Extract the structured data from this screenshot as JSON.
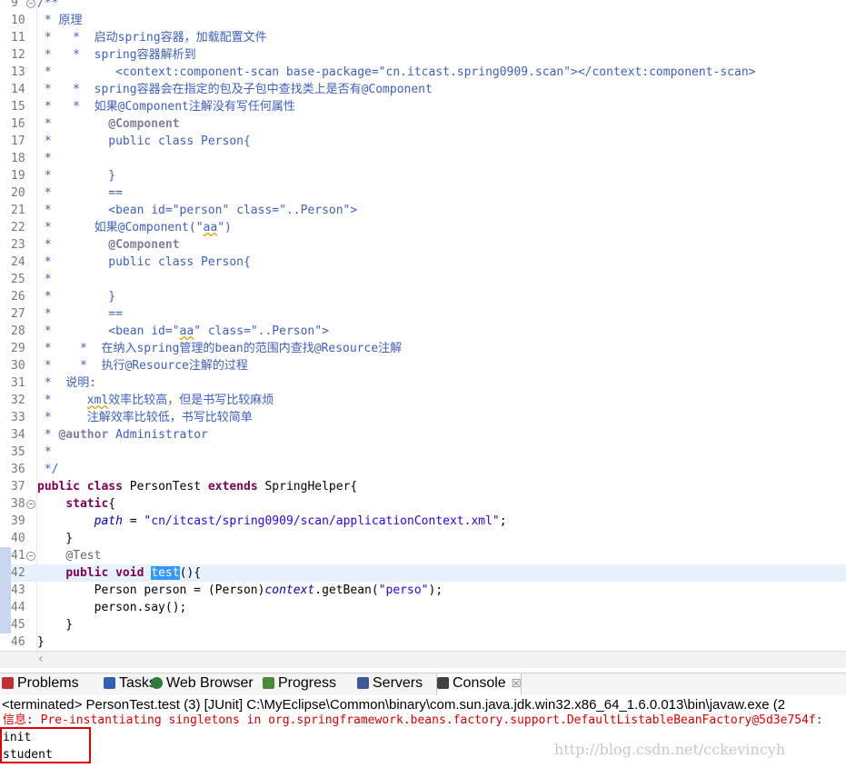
{
  "editor": {
    "lines": [
      {
        "n": "9",
        "fold": "−",
        "segs": [
          {
            "c": "cm",
            "t": "/**"
          }
        ]
      },
      {
        "n": "10",
        "segs": [
          {
            "c": "cm",
            "t": " * 原理"
          }
        ]
      },
      {
        "n": "11",
        "segs": [
          {
            "c": "cm",
            "t": " *   *  启动spring容器，加载配置文件"
          }
        ]
      },
      {
        "n": "12",
        "segs": [
          {
            "c": "cm",
            "t": " *   *  spring容器解析到"
          }
        ]
      },
      {
        "n": "13",
        "segs": [
          {
            "c": "cm",
            "t": " *         <context:component-scan base-package=\"cn.itcast.spring0909.scan\"></context:component-scan>"
          }
        ]
      },
      {
        "n": "14",
        "segs": [
          {
            "c": "cm",
            "t": " *   *  spring容器会在指定的包及子包中查找类上是否有@Component"
          }
        ]
      },
      {
        "n": "15",
        "segs": [
          {
            "c": "cm",
            "t": " *   *  如果@Component注解没有写任何属性"
          }
        ]
      },
      {
        "n": "16",
        "segs": [
          {
            "c": "cm",
            "t": " *        "
          },
          {
            "c": "tagcm",
            "t": "@Component"
          }
        ]
      },
      {
        "n": "17",
        "segs": [
          {
            "c": "cm",
            "t": " *        public class Person{"
          }
        ]
      },
      {
        "n": "18",
        "segs": [
          {
            "c": "cm",
            "t": " *"
          }
        ]
      },
      {
        "n": "19",
        "segs": [
          {
            "c": "cm",
            "t": " *        }"
          }
        ]
      },
      {
        "n": "20",
        "segs": [
          {
            "c": "cm",
            "t": " *        =="
          }
        ]
      },
      {
        "n": "21",
        "segs": [
          {
            "c": "cm",
            "t": " *        <bean id=\"person\" class=\"..Person\">"
          }
        ]
      },
      {
        "n": "22",
        "segs": [
          {
            "c": "cm",
            "t": " *      如果@Component(\""
          },
          {
            "c": "cm squig",
            "t": "aa"
          },
          {
            "c": "cm",
            "t": "\")"
          }
        ]
      },
      {
        "n": "23",
        "segs": [
          {
            "c": "cm",
            "t": " *        "
          },
          {
            "c": "tagcm",
            "t": "@Component"
          }
        ]
      },
      {
        "n": "24",
        "segs": [
          {
            "c": "cm",
            "t": " *        public class Person{"
          }
        ]
      },
      {
        "n": "25",
        "segs": [
          {
            "c": "cm",
            "t": " *"
          }
        ]
      },
      {
        "n": "26",
        "segs": [
          {
            "c": "cm",
            "t": " *        }"
          }
        ]
      },
      {
        "n": "27",
        "segs": [
          {
            "c": "cm",
            "t": " *        =="
          }
        ]
      },
      {
        "n": "28",
        "segs": [
          {
            "c": "cm",
            "t": " *        <bean id=\""
          },
          {
            "c": "cm squig",
            "t": "aa"
          },
          {
            "c": "cm",
            "t": "\" class=\"..Person\">"
          }
        ]
      },
      {
        "n": "29",
        "segs": [
          {
            "c": "cm",
            "t": " *    *  在纳入spring管理的bean的范围内查找@Resource注解"
          }
        ]
      },
      {
        "n": "30",
        "segs": [
          {
            "c": "cm",
            "t": " *    *  执行@Resource注解的过程"
          }
        ]
      },
      {
        "n": "31",
        "segs": [
          {
            "c": "cm",
            "t": " *  说明:"
          }
        ]
      },
      {
        "n": "32",
        "segs": [
          {
            "c": "cm",
            "t": " *     "
          },
          {
            "c": "cm squig",
            "t": "xml"
          },
          {
            "c": "cm",
            "t": "效率比较高，但是书写比较麻烦"
          }
        ]
      },
      {
        "n": "33",
        "segs": [
          {
            "c": "cm",
            "t": " *     注解效率比较低，书写比较简单"
          }
        ]
      },
      {
        "n": "34",
        "segs": [
          {
            "c": "cm",
            "t": " * "
          },
          {
            "c": "tagcm",
            "t": "@author"
          },
          {
            "c": "cm",
            "t": " Administrator"
          }
        ]
      },
      {
        "n": "35",
        "segs": [
          {
            "c": "cm",
            "t": " *"
          }
        ]
      },
      {
        "n": "36",
        "segs": [
          {
            "c": "cm",
            "t": " */"
          }
        ]
      },
      {
        "n": "37",
        "segs": [
          {
            "c": "kw",
            "t": "public"
          },
          {
            "c": "",
            "t": " "
          },
          {
            "c": "kw",
            "t": "class"
          },
          {
            "c": "",
            "t": " PersonTest "
          },
          {
            "c": "kw",
            "t": "extends"
          },
          {
            "c": "",
            "t": " SpringHelper{"
          }
        ]
      },
      {
        "n": "38",
        "fold": "−",
        "segs": [
          {
            "c": "",
            "t": "    "
          },
          {
            "c": "kw",
            "t": "static"
          },
          {
            "c": "",
            "t": "{"
          }
        ]
      },
      {
        "n": "39",
        "segs": [
          {
            "c": "",
            "t": "        "
          },
          {
            "c": "fld",
            "t": "path"
          },
          {
            "c": "",
            "t": " = "
          },
          {
            "c": "str",
            "t": "\"cn/itcast/spring0909/scan/applicationContext.xml\""
          },
          {
            "c": "",
            "t": ";"
          }
        ]
      },
      {
        "n": "40",
        "segs": [
          {
            "c": "",
            "t": "    }"
          }
        ]
      },
      {
        "n": "41",
        "fold": "−",
        "bar": true,
        "segs": [
          {
            "c": "",
            "t": "    "
          },
          {
            "c": "ann",
            "t": "@Test"
          }
        ]
      },
      {
        "n": "42",
        "bar": true,
        "current": true,
        "segs": [
          {
            "c": "",
            "t": "    "
          },
          {
            "c": "kw",
            "t": "public"
          },
          {
            "c": "",
            "t": " "
          },
          {
            "c": "kw",
            "t": "void"
          },
          {
            "c": "",
            "t": " "
          },
          {
            "c": "sel",
            "t": "test"
          },
          {
            "c": "",
            "t": "(){"
          }
        ]
      },
      {
        "n": "43",
        "bar": true,
        "segs": [
          {
            "c": "",
            "t": "        Person person = (Person)"
          },
          {
            "c": "fld",
            "t": "context"
          },
          {
            "c": "",
            "t": ".getBean("
          },
          {
            "c": "str",
            "t": "\"perso\""
          },
          {
            "c": "",
            "t": ");"
          }
        ]
      },
      {
        "n": "44",
        "bar": true,
        "segs": [
          {
            "c": "",
            "t": "        person.say();"
          }
        ]
      },
      {
        "n": "45",
        "bar": true,
        "segs": [
          {
            "c": "",
            "t": "    }"
          }
        ]
      },
      {
        "n": "46",
        "segs": [
          {
            "c": "",
            "t": "}"
          }
        ]
      }
    ]
  },
  "tabs": [
    {
      "label": "Problems",
      "icon": "problems-icon",
      "color": "#c03030"
    },
    {
      "label": "Tasks",
      "icon": "tasks-icon",
      "color": "#3060b0"
    },
    {
      "label": "Web Browser",
      "icon": "globe-icon",
      "color": "#2c7a3a"
    },
    {
      "label": "Progress",
      "icon": "progress-icon",
      "color": "#4a8a3a"
    },
    {
      "label": "Servers",
      "icon": "servers-icon",
      "color": "#3a5a9a"
    },
    {
      "label": "Console",
      "icon": "console-icon",
      "color": "#404040",
      "active": true,
      "close": "☒"
    }
  ],
  "console": {
    "terminated": "<terminated> PersonTest.test (3) [JUnit] C:\\MyEclipse\\Common\\binary\\com.sun.java.jdk.win32.x86_64_1.6.0.013\\bin\\javaw.exe (2",
    "info": "信息: Pre-instantiating singletons in org.springframework.beans.factory.support.DefaultListableBeanFactory@5d3e754f:",
    "out1": "init",
    "out2": "student"
  },
  "watermark": "http://blog.csdn.net/cckevincyh",
  "colors": {
    "comment": "#3f5fbf",
    "keyword": "#7f0055",
    "string": "#2a00ff",
    "field": "#0000c0",
    "selection": "#3399ff",
    "error": "#dd0000"
  }
}
